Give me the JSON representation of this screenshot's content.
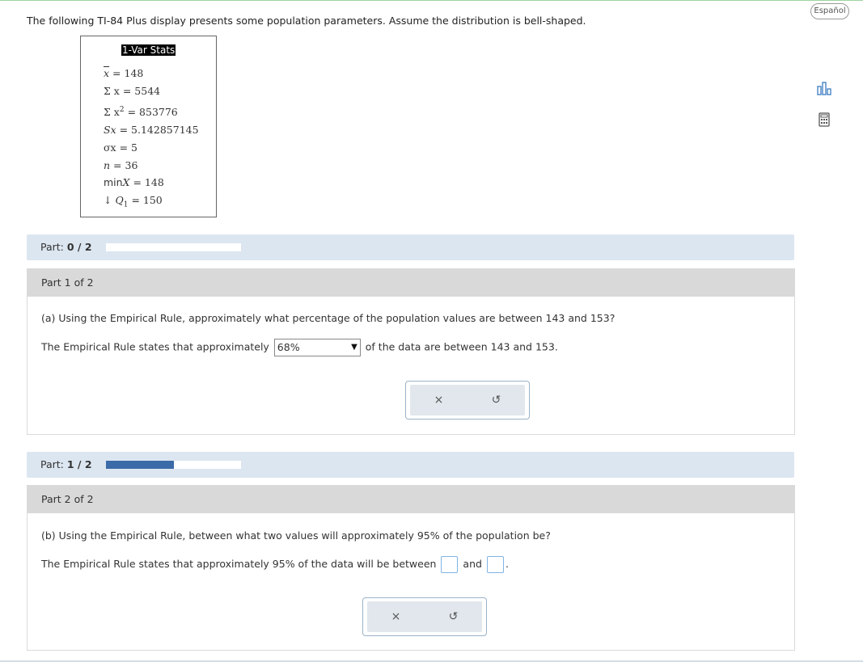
{
  "language_button": "Español",
  "question": "The following TI-84 Plus display presents some population parameters. Assume the distribution is bell-shaped.",
  "calculator": {
    "title": "1-Var Stats",
    "mean_sym": "x",
    "mean_val": "= 148",
    "sum_x_sym": "Σ x",
    "sum_x_val": "= 5544",
    "sum_x2_sym": "Σ x",
    "sum_x2_exp": "2",
    "sum_x2_val": "= 853776",
    "sx_sym": "Sx",
    "sx_val": "= 5.142857145",
    "sigma_sym": "σx",
    "sigma_val": "= 5",
    "n_sym": "n",
    "n_val": "= 36",
    "min_label": "min",
    "min_sym": "X",
    "min_val": "= 148",
    "q1_prefix": "↓",
    "q1_sym": "Q",
    "q1_sub": "1",
    "q1_val": "= 150"
  },
  "part1_bar": {
    "label": "Part:",
    "value": "0 / 2",
    "progress": 0
  },
  "part1": {
    "header": "Part 1 of 2",
    "question": "(a) Using the Empirical Rule, approximately what percentage of the population values are between 143 and 153?",
    "answer_prefix": "The Empirical Rule states that approximately",
    "selected": "68%",
    "answer_suffix": "of the data are between 143 and 153.",
    "clear": "×",
    "undo": "↺"
  },
  "part2_bar": {
    "label": "Part:",
    "value": "1 / 2",
    "progress": 0.5
  },
  "part2": {
    "header": "Part 2 of 2",
    "question": "(b) Using the Empirical Rule, between what two values will approximately 95% of the population be?",
    "answer_prefix": "The Empirical Rule states that approximately 95% of the data will be between",
    "answer_mid": "and",
    "answer_end": ".",
    "clear": "×",
    "undo": "↺"
  },
  "colors": {
    "progress_fill": "#3b6aa8",
    "part_bar_bg": "#dce6f0",
    "part_head_bg": "#d9d9d9"
  }
}
